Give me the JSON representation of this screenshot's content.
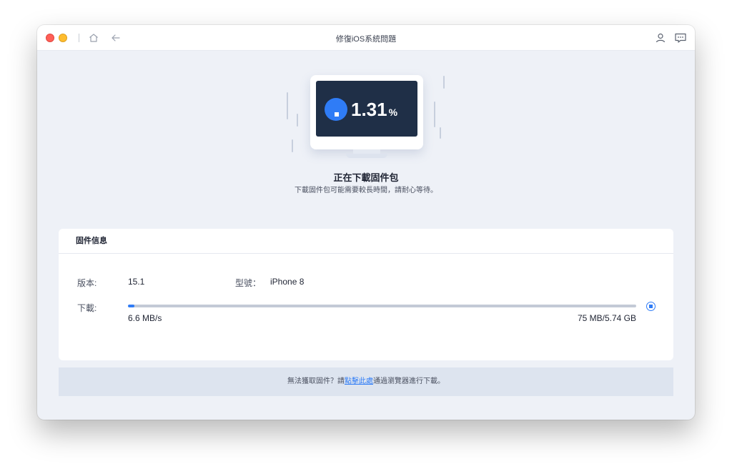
{
  "window": {
    "title": "修復iOS系統問題"
  },
  "icons": {
    "home": "home-icon",
    "back": "arrow-left-icon",
    "user": "user-icon",
    "feedback": "message-icon"
  },
  "progress": {
    "percent_value": "1.31",
    "percent_sign": "%",
    "fraction": 0.0131
  },
  "status": {
    "title": "正在下載固件包",
    "subtitle": "下載固件包可能需要較長時間，請耐心等待。"
  },
  "firmware": {
    "header": "固件信息",
    "version_label": "版本:",
    "version_value": "15.1",
    "model_label": "型號：",
    "model_value": "iPhone 8",
    "download_label": "下載:",
    "speed": "6.6 MB/s",
    "size": "75 MB/5.74 GB"
  },
  "footer": {
    "text_before": "無法獲取固件？請",
    "link": "點擊此處",
    "text_after": "通過瀏覽器進行下載。"
  },
  "colors": {
    "accent": "#2f7cf6",
    "screen": "#1f2f47"
  }
}
